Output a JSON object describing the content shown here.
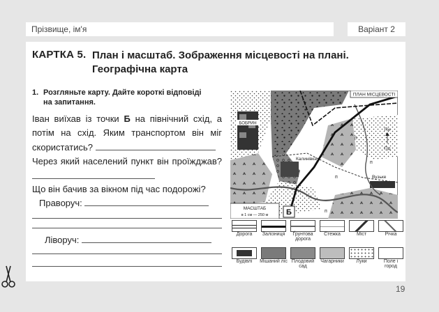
{
  "header": {
    "name_label": "Прізвище, ім'я",
    "variant": "Варіант 2"
  },
  "card": {
    "label": "КАРТКА 5.",
    "title_line1": "План і масштаб. Зображення місцевості на плані.",
    "title_line2": "Географічна карта"
  },
  "task": {
    "number": "1.",
    "line1": "Розгляньте карту. Дайте короткі відповіді",
    "line2": "на запитання."
  },
  "questions": {
    "q1_a": "Іван виїхав із точки ",
    "q1_b": "Б",
    "q1_c": " на північний схід, а потім на схід. Яким транспортом він міг скористатись?",
    "q2": "Через який населений пункт він проїжджав?",
    "q3": "Що він бачив за вікном під час подорожі?",
    "right_label": "Праворуч:",
    "left_label": "Ліворуч:"
  },
  "map": {
    "plan_title": "ПЛАН МІСЦЕВОСТІ",
    "village_bobryn": "БОБРИН",
    "village_kalynivka": "Калинівка",
    "village_vuzke": "Вузьке",
    "point_b": "Б",
    "north": "Пн",
    "south": "Пд",
    "meadow": "п",
    "scale_title": "МАСШТАБ",
    "scale_text": "в 1 см — 250 м"
  },
  "legend": [
    {
      "id": "road",
      "label": "Дорога"
    },
    {
      "id": "railway",
      "label": "Залізниця"
    },
    {
      "id": "dirt-road",
      "label": "Ґрунтова дорога"
    },
    {
      "id": "path",
      "label": "Стежка"
    },
    {
      "id": "bridge",
      "label": "Міст"
    },
    {
      "id": "river",
      "label": "Річка"
    },
    {
      "id": "buildings",
      "label": "Будівлі"
    },
    {
      "id": "mixed-forest",
      "label": "Мішаний ліс"
    },
    {
      "id": "orchard",
      "label": "Плодовий сад"
    },
    {
      "id": "shrubs",
      "label": "Чагарники"
    },
    {
      "id": "meadows",
      "label": "Луки"
    },
    {
      "id": "field-garden",
      "label": "Поле і город"
    }
  ],
  "page_number": "19"
}
